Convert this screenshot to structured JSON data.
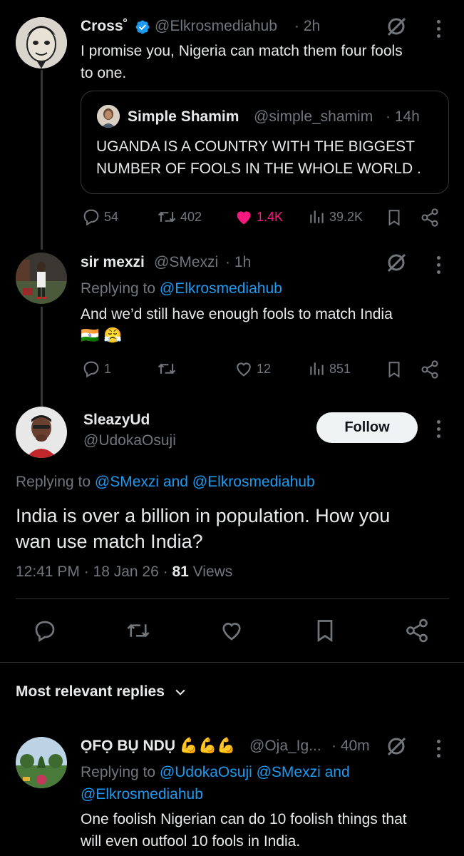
{
  "tweet1": {
    "name": "Cross˚",
    "handle": "@Elkrosmediahub",
    "time": "· 2h",
    "text_line1": "I promise you, Nigeria can match them four fools",
    "text_line2": "to one.",
    "quote": {
      "name": "Simple Shamim",
      "handle": "@simple_shamim",
      "time": "· 14h",
      "text_line1": "UGANDA IS A COUNTRY WITH THE BIGGEST",
      "text_line2": "NUMBER OF FOOLS IN THE WHOLE WORLD ."
    },
    "replies": "54",
    "reposts": "402",
    "likes": "1.4K",
    "views": "39.2K"
  },
  "tweet2": {
    "name": "sir mexzi",
    "handle": "@SMexzi",
    "time": "· 1h",
    "replying_prefix": "Replying to ",
    "replying_to": "@Elkrosmediahub",
    "text_line1": "And we’d still have enough fools to match India",
    "emoji": "🇮🇳 😤",
    "replies": "1",
    "likes": "12",
    "views": "851"
  },
  "main": {
    "name": "SleazyUd",
    "handle": "@UdokaOsuji",
    "follow_label": "Follow",
    "replying_prefix": "Replying to ",
    "replying_to": "@SMexzi and @Elkrosmediahub",
    "text_line1": "India is over a billion in population.  How you",
    "text_line2": "wan use match India?",
    "timestamp": "12:41 PM · 18 Jan 26 · ",
    "views_count": "81",
    "views_label": " Views"
  },
  "replies_sort": {
    "label": "Most relevant replies"
  },
  "reply1": {
    "name": "ỌFỌ BỤ NDỤ 💪💪💪",
    "handle": "@Oja_Ig...",
    "time": "· 40m",
    "replying_prefix": "Replying to ",
    "replying_to_line1": "@UdokaOsuji @SMexzi and",
    "replying_to_line2": "@Elkrosmediahub",
    "text_line1": "One foolish Nigerian can do 10 foolish things that",
    "text_line2": "will even outfool 10 fools in India."
  },
  "colors": {
    "like_active": "#f91880",
    "link": "#1d9bf0",
    "verified": "#1d9bf0"
  }
}
